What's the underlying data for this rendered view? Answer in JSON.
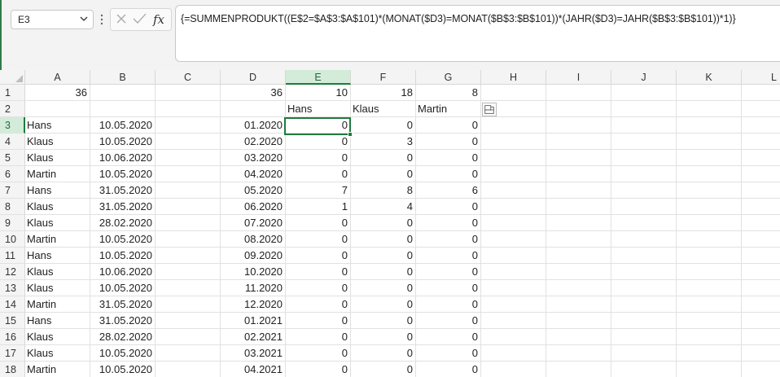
{
  "formula_bar": {
    "name_box": "E3",
    "fx_label": "fx",
    "formula": "{=SUMMENPRODUKT((E$2=$A$3:$A$101)*(MONAT($D3)=MONAT($B$3:$B$101))*(JAHR($D3)=JAHR($B$3:$B$101))*1)}"
  },
  "colors": {
    "accent": "#1f7a3f",
    "header_selected": "#d3ecd9"
  },
  "grid": {
    "selected_cell": "E3",
    "columns": [
      "A",
      "B",
      "C",
      "D",
      "E",
      "F",
      "G",
      "H",
      "I",
      "J",
      "K",
      "L"
    ],
    "row_numbers": [
      "1",
      "2",
      "3",
      "4",
      "5",
      "6",
      "7",
      "8",
      "9",
      "10",
      "11",
      "12",
      "13",
      "14",
      "15",
      "16",
      "17",
      "18"
    ],
    "rows": [
      [
        "36",
        "",
        "",
        "36",
        "10",
        "18",
        "8"
      ],
      [
        "",
        "",
        "",
        "",
        "Hans",
        "Klaus",
        "Martin"
      ],
      [
        "Hans",
        "10.05.2020",
        "",
        "01.2020",
        "0",
        "0",
        "0"
      ],
      [
        "Klaus",
        "10.05.2020",
        "",
        "02.2020",
        "0",
        "3",
        "0"
      ],
      [
        "Klaus",
        "10.06.2020",
        "",
        "03.2020",
        "0",
        "0",
        "0"
      ],
      [
        "Martin",
        "10.05.2020",
        "",
        "04.2020",
        "0",
        "0",
        "0"
      ],
      [
        "Hans",
        "31.05.2020",
        "",
        "05.2020",
        "7",
        "8",
        "6"
      ],
      [
        "Klaus",
        "31.05.2020",
        "",
        "06.2020",
        "1",
        "4",
        "0"
      ],
      [
        "Klaus",
        "28.02.2020",
        "",
        "07.2020",
        "0",
        "0",
        "0"
      ],
      [
        "Martin",
        "10.05.2020",
        "",
        "08.2020",
        "0",
        "0",
        "0"
      ],
      [
        "Hans",
        "10.05.2020",
        "",
        "09.2020",
        "0",
        "0",
        "0"
      ],
      [
        "Klaus",
        "10.06.2020",
        "",
        "10.2020",
        "0",
        "0",
        "0"
      ],
      [
        "Klaus",
        "10.05.2020",
        "",
        "11.2020",
        "0",
        "0",
        "0"
      ],
      [
        "Martin",
        "31.05.2020",
        "",
        "12.2020",
        "0",
        "0",
        "0"
      ],
      [
        "Hans",
        "31.05.2020",
        "",
        "01.2021",
        "0",
        "0",
        "0"
      ],
      [
        "Klaus",
        "28.02.2020",
        "",
        "02.2021",
        "0",
        "0",
        "0"
      ],
      [
        "Klaus",
        "10.05.2020",
        "",
        "03.2021",
        "0",
        "0",
        "0"
      ],
      [
        "Martin",
        "10.05.2020",
        "",
        "04.2021",
        "0",
        "0",
        "0"
      ]
    ]
  }
}
